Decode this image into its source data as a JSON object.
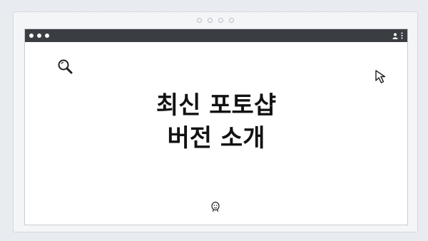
{
  "window": {
    "traffic_lights": [
      "close",
      "minimize",
      "maximize"
    ],
    "toolbar_icons": [
      "profile-icon",
      "kebab-menu-icon"
    ]
  },
  "content": {
    "headline": {
      "line1": "최신 포토샵",
      "line2": "버전 소개"
    },
    "icons": [
      "search-icon",
      "cursor-arrow-icon",
      "smiley-face-icon"
    ]
  },
  "colors": {
    "titlebar": "#3a3d42",
    "page_background": "#e8ebef",
    "content_background": "#ffffff",
    "headline_text": "#121212"
  }
}
